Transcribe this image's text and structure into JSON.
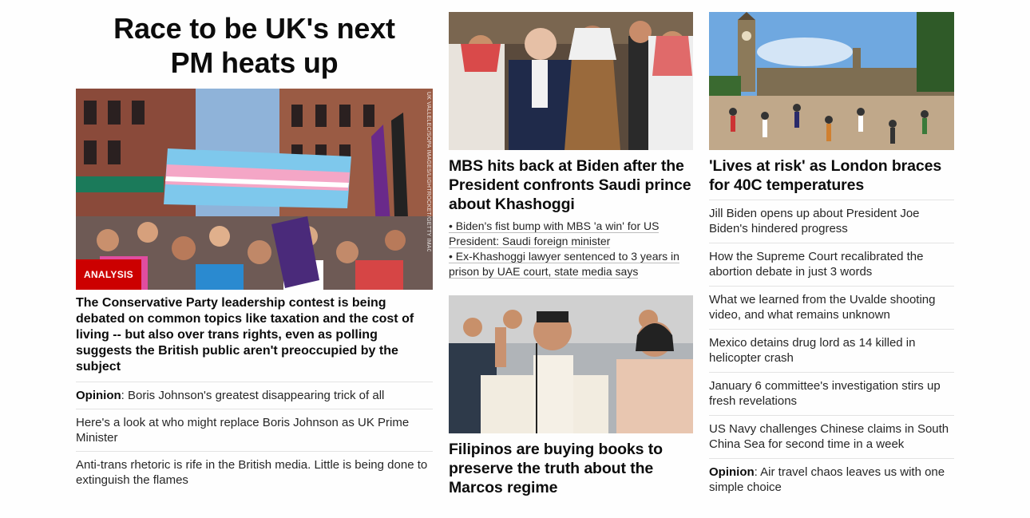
{
  "col1": {
    "headline_line1": "Race to be UK's next",
    "headline_line2": "PM heats up",
    "image_credit": "UK VALLELEC/SOPA IMAGES/LIGHTROCKET/GETTY IMAGES",
    "badge": "ANALYSIS",
    "lead": "The Conservative Party leadership contest is being debated on common topics like taxation and the cost of living -- but also over trans rights, even as polling suggests the British public aren't preoccupied by the subject",
    "links": [
      {
        "prefix": "Opinion",
        "text": ": Boris Johnson's greatest disappearing trick of all"
      },
      {
        "prefix": "",
        "text": "Here's a look at who might replace Boris Johnson as UK Prime Minister"
      },
      {
        "prefix": "",
        "text": "Anti-trans rhetoric is rife in the British media. Little is being done to extinguish the flames"
      }
    ]
  },
  "col2": {
    "story1": {
      "title": "MBS hits back at Biden after the President confronts Saudi prince about Khashoggi",
      "bullets": [
        "• Biden's fist bump with MBS 'a win' for US President: Saudi foreign minister",
        "• Ex-Khashoggi lawyer sentenced to 3 years in prison by UAE court, state media says"
      ]
    },
    "story2": {
      "title": "Filipinos are buying books to preserve the truth about the Marcos regime"
    }
  },
  "col3": {
    "title": "'Lives at risk' as London braces for 40C temperatures",
    "links": [
      {
        "prefix": "",
        "text": "Jill Biden opens up about President Joe Biden's hindered progress"
      },
      {
        "prefix": "",
        "text": "How the Supreme Court recalibrated the abortion debate in just 3 words"
      },
      {
        "prefix": "",
        "text": "What we learned from the Uvalde shooting video, and what remains unknown"
      },
      {
        "prefix": "",
        "text": "Mexico detains drug lord as 14 killed in helicopter crash"
      },
      {
        "prefix": "",
        "text": "January 6 committee's investigation stirs up fresh revelations"
      },
      {
        "prefix": "",
        "text": "US Navy challenges Chinese claims in South China Sea for second time in a week"
      },
      {
        "prefix": "Opinion",
        "text": ": Air travel chaos leaves us with one simple choice"
      }
    ]
  },
  "colors": {
    "badge_red": "#cc0000",
    "divider": "#e3e3e3",
    "text": "#0c0c0c"
  }
}
